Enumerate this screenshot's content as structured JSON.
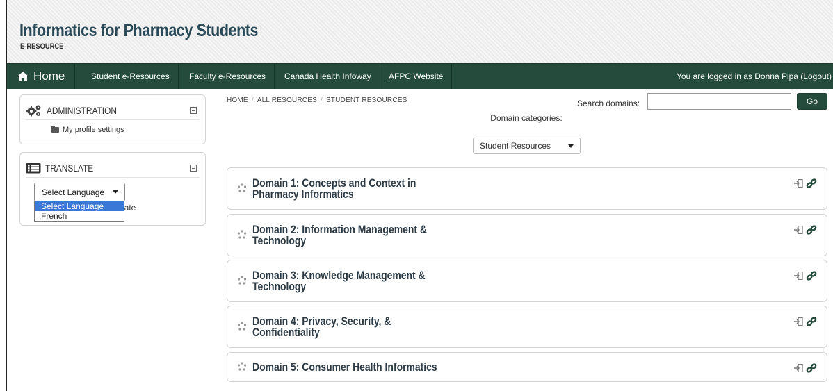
{
  "header": {
    "title": "Informatics for Pharmacy Students",
    "subtitle": "E-RESOURCE"
  },
  "nav": {
    "home": "Home",
    "items": [
      "Student e-Resources",
      "Faculty e-Resources",
      "Canada Health Infoway",
      "AFPC Website"
    ],
    "login_text": "You are logged in as Donna Pipa (Logout)"
  },
  "admin_block": {
    "title": "ADMINISTRATION",
    "link": "My profile settings"
  },
  "translate_block": {
    "title": "TRANSLATE",
    "select_value": "Select Language",
    "options": [
      "Select Language",
      "French"
    ],
    "behind_text": "slate"
  },
  "breadcrumb": [
    "HOME",
    "ALL RESOURCES",
    "STUDENT RESOURCES"
  ],
  "search": {
    "label": "Search domains:",
    "value": "",
    "button": "Go"
  },
  "categories": {
    "label": "Domain categories:",
    "selected": "Student Resources"
  },
  "domains": [
    {
      "line1": "Domain 1: Concepts and Context in",
      "line2": "Pharmacy Informatics"
    },
    {
      "line1": "Domain 2: Information Management &",
      "line2": "Technology"
    },
    {
      "line1": "Domain 3: Knowledge Management &",
      "line2": "Technology"
    },
    {
      "line1": "Domain 4: Privacy, Security, &",
      "line2": "Confidentiality"
    },
    {
      "line1": "Domain 5: Consumer Health Informatics",
      "line2": ""
    }
  ],
  "colors": {
    "navbar": "#254b3c",
    "title": "#2b4a58",
    "selected_option": "#3a78d8"
  },
  "icons": [
    "home-icon",
    "gears-icon",
    "list-icon",
    "folder-icon",
    "collapse-icon",
    "move-icon",
    "enter-icon",
    "link-icon"
  ]
}
